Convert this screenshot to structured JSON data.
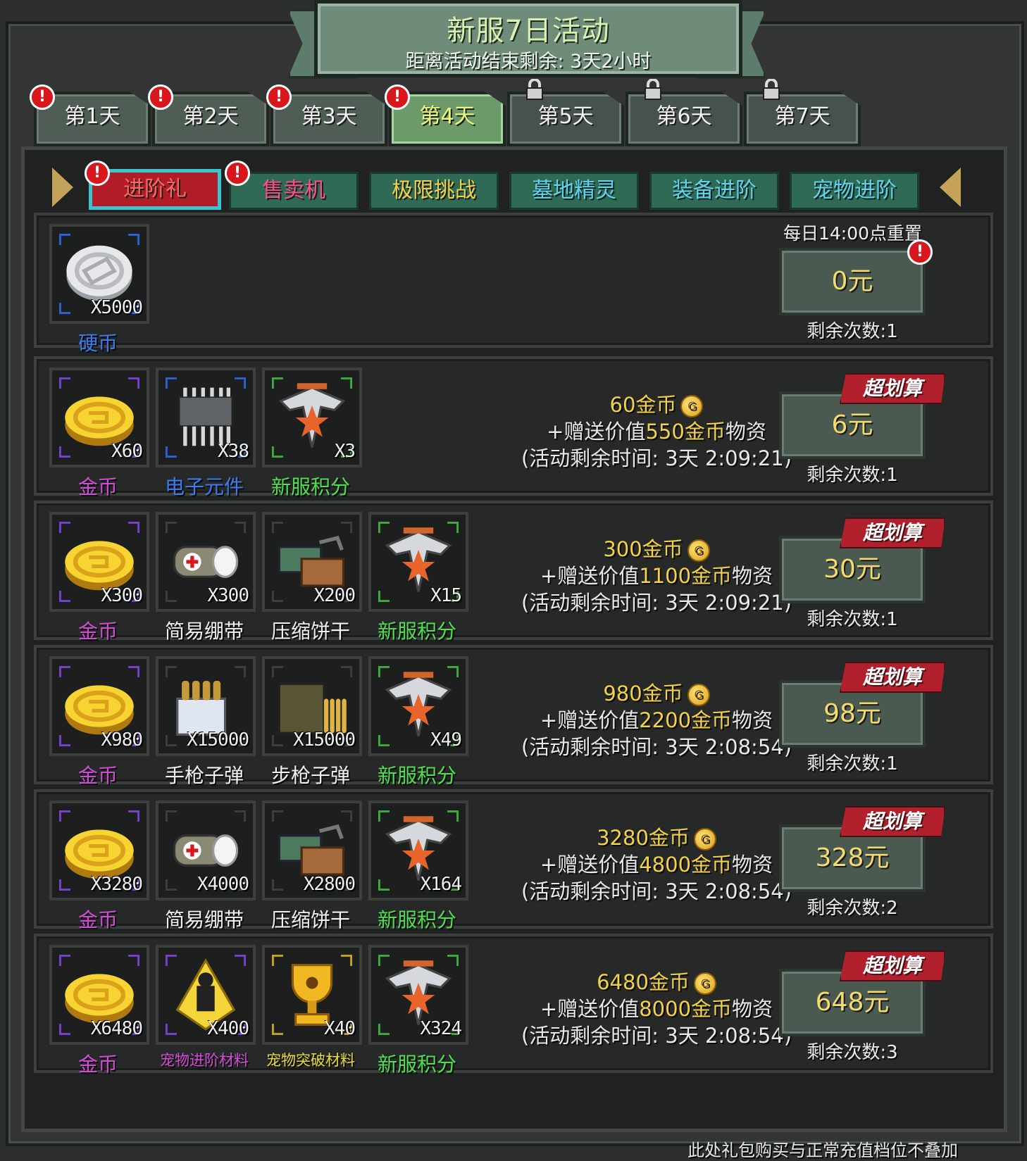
{
  "header": {
    "title": "新服7日活动",
    "countdown": "距离活动结束剩余: 3天2小时"
  },
  "day_tabs": [
    {
      "label": "第1天",
      "badge": "!",
      "state": "normal"
    },
    {
      "label": "第2天",
      "badge": "!",
      "state": "normal"
    },
    {
      "label": "第3天",
      "badge": "!",
      "state": "normal"
    },
    {
      "label": "第4天",
      "badge": "!",
      "state": "active"
    },
    {
      "label": "第5天",
      "badge": "",
      "state": "locked"
    },
    {
      "label": "第6天",
      "badge": "",
      "state": "locked"
    },
    {
      "label": "第7天",
      "badge": "",
      "state": "locked"
    }
  ],
  "sub_tabs": [
    {
      "label": "进阶礼",
      "badge": "!",
      "active": true
    },
    {
      "label": "售卖机",
      "badge": "!",
      "active": false
    },
    {
      "label": "极限挑战",
      "badge": "",
      "active": false
    },
    {
      "label": "墓地精灵",
      "badge": "",
      "active": false
    },
    {
      "label": "装备进阶",
      "badge": "",
      "active": false
    },
    {
      "label": "宠物进阶",
      "badge": "",
      "active": false
    }
  ],
  "free_pack": {
    "reset_text": "每日14:00点重置",
    "item": {
      "name": "硬币",
      "qty": "X5000",
      "icon": "silver-coin-icon"
    },
    "price": "0元",
    "badge": "!",
    "remaining": "剩余次数:1"
  },
  "packs": [
    {
      "items": [
        {
          "name": "金币",
          "qty": "X60",
          "icon": "gold-coin-icon"
        },
        {
          "name": "电子元件",
          "qty": "X38",
          "icon": "chip-icon"
        },
        {
          "name": "新服积分",
          "qty": "X3",
          "icon": "eagle-badge-icon"
        }
      ],
      "gold_amount": "60金币",
      "bonus_prefix": "+赠送价值",
      "bonus_value": "550金币",
      "bonus_suffix": "物资",
      "timer": "(活动剩余时间: 3天 2:09:21)",
      "ribbon": "超划算",
      "price": "6元",
      "remaining": "剩余次数:1"
    },
    {
      "items": [
        {
          "name": "金币",
          "qty": "X300",
          "icon": "gold-coin-icon"
        },
        {
          "name": "简易绷带",
          "qty": "X300",
          "icon": "bandage-icon"
        },
        {
          "name": "压缩饼干",
          "qty": "X200",
          "icon": "biscuit-icon"
        },
        {
          "name": "新服积分",
          "qty": "X15",
          "icon": "eagle-badge-icon"
        }
      ],
      "gold_amount": "300金币",
      "bonus_prefix": "+赠送价值",
      "bonus_value": "1100金币",
      "bonus_suffix": "物资",
      "timer": "(活动剩余时间: 3天 2:09:21)",
      "ribbon": "超划算",
      "price": "30元",
      "remaining": "剩余次数:1"
    },
    {
      "items": [
        {
          "name": "金币",
          "qty": "X980",
          "icon": "gold-coin-icon"
        },
        {
          "name": "手枪子弹",
          "qty": "X15000",
          "icon": "pistol-ammo-icon"
        },
        {
          "name": "步枪子弹",
          "qty": "X15000",
          "icon": "rifle-ammo-icon"
        },
        {
          "name": "新服积分",
          "qty": "X49",
          "icon": "eagle-badge-icon"
        }
      ],
      "gold_amount": "980金币",
      "bonus_prefix": "+赠送价值",
      "bonus_value": "2200金币",
      "bonus_suffix": "物资",
      "timer": "(活动剩余时间: 3天 2:08:54)",
      "ribbon": "超划算",
      "price": "98元",
      "remaining": "剩余次数:1"
    },
    {
      "items": [
        {
          "name": "金币",
          "qty": "X3280",
          "icon": "gold-coin-icon"
        },
        {
          "name": "简易绷带",
          "qty": "X4000",
          "icon": "bandage-icon"
        },
        {
          "name": "压缩饼干",
          "qty": "X2800",
          "icon": "biscuit-icon"
        },
        {
          "name": "新服积分",
          "qty": "X164",
          "icon": "eagle-badge-icon"
        }
      ],
      "gold_amount": "3280金币",
      "bonus_prefix": "+赠送价值",
      "bonus_value": "4800金币",
      "bonus_suffix": "物资",
      "timer": "(活动剩余时间: 3天 2:08:54)",
      "ribbon": "超划算",
      "price": "328元",
      "remaining": "剩余次数:2"
    },
    {
      "items": [
        {
          "name": "金币",
          "qty": "X6480",
          "icon": "gold-coin-icon"
        },
        {
          "name": "宠物进阶材料",
          "qty": "X400",
          "icon": "pet-advance-material-icon"
        },
        {
          "name": "宠物突破材料",
          "qty": "X40",
          "icon": "trophy-icon"
        },
        {
          "name": "新服积分",
          "qty": "X324",
          "icon": "eagle-badge-icon"
        }
      ],
      "gold_amount": "6480金币",
      "bonus_prefix": "+赠送价值",
      "bonus_value": "8000金币",
      "bonus_suffix": "物资",
      "timer": "(活动剩余时间: 3天 2:08:54)",
      "ribbon": "超划算",
      "price": "648元",
      "remaining": "剩余次数:3"
    }
  ],
  "footer_note": "此处礼包购买与正常充值档位不叠加",
  "colors": {
    "gold_text": "#f2d04b",
    "name_purple": "#d44ad8",
    "name_blue": "#3a7cf0",
    "name_green": "#4fe04f",
    "name_white": "#f0f0f0",
    "name_yellow": "#e8d83a",
    "badge_red": "#d8161c"
  }
}
